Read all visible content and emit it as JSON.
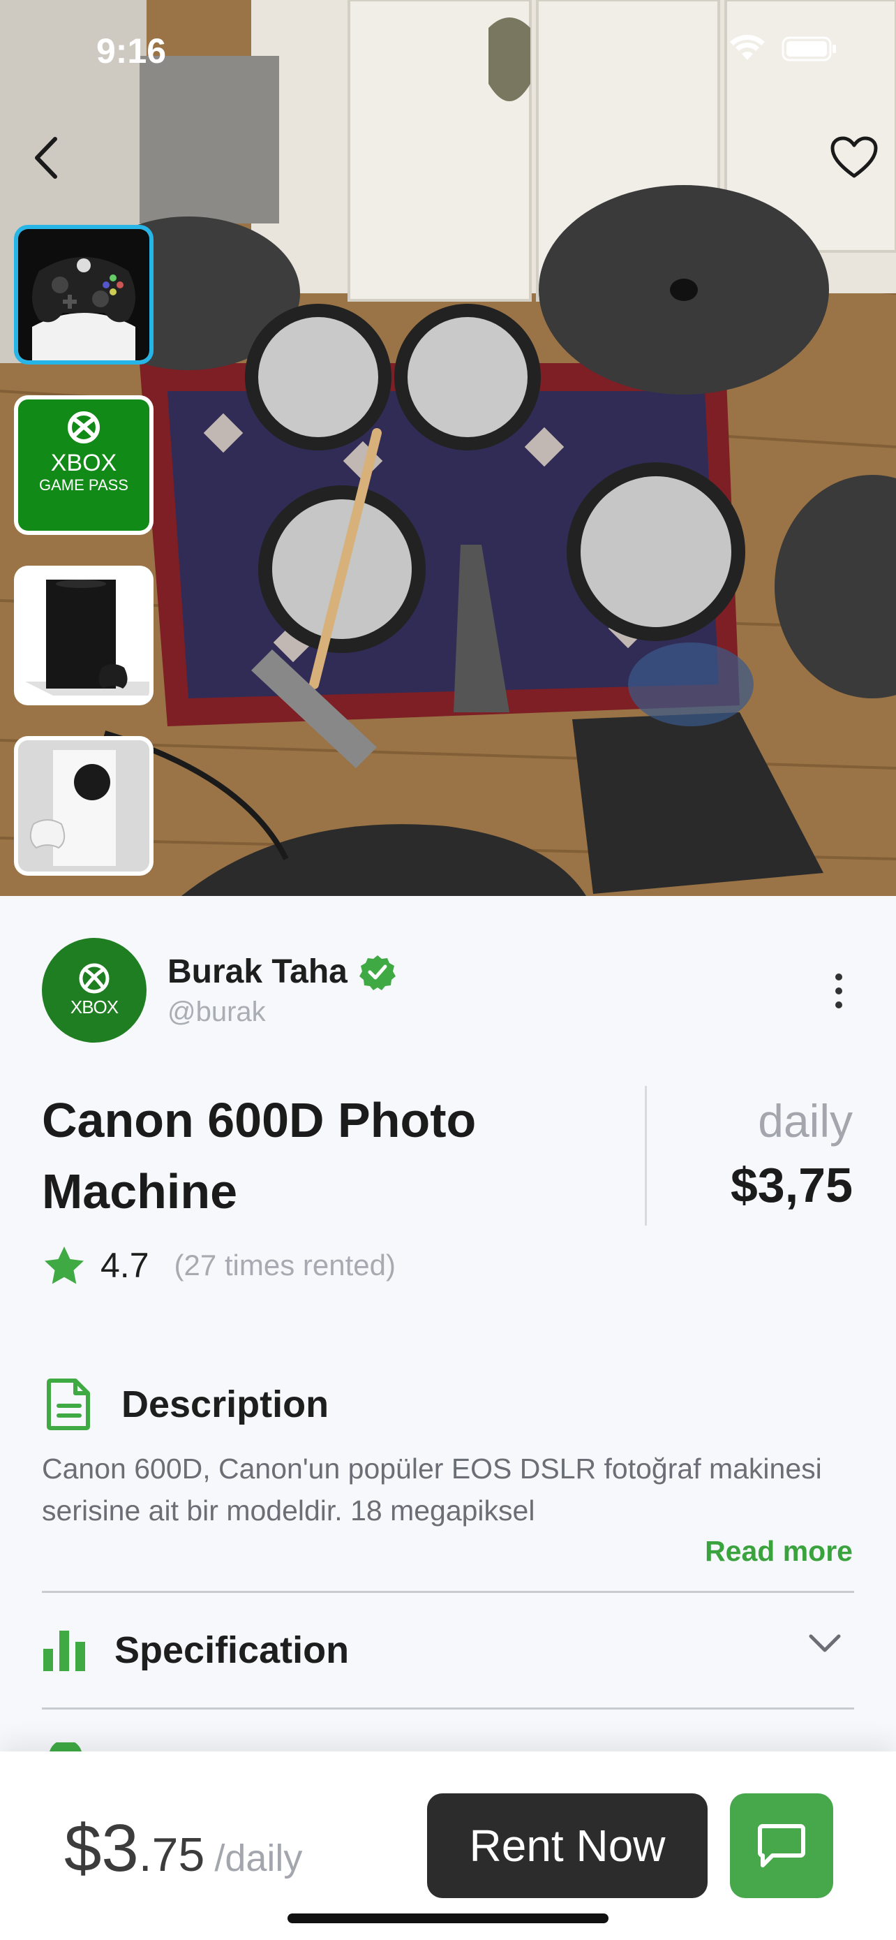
{
  "status_bar": {
    "time": "9:16",
    "icons": [
      "wifi-icon",
      "battery-icon"
    ]
  },
  "hero": {
    "icons": {
      "back": "chevron-left-icon",
      "favorite": "heart-icon"
    },
    "thumbnails": [
      {
        "name": "xbox-controller",
        "selected": true
      },
      {
        "name": "xbox-game-pass",
        "line1": "XBOX",
        "line2": "GAME PASS",
        "selected": false
      },
      {
        "name": "xbox-series-x",
        "selected": false
      },
      {
        "name": "xbox-series-s",
        "selected": false
      }
    ]
  },
  "seller": {
    "avatar_text": "XBOX",
    "name": "Burak Taha",
    "handle": "@burak",
    "verified_icon": "verified-badge-icon"
  },
  "product": {
    "title": "Canon 600D Photo Machine",
    "price_period": "daily",
    "price": "$3,75",
    "rating": "4.7",
    "rating_count": "(27 times rented)"
  },
  "description": {
    "title": "Description",
    "text": "Canon 600D, Canon'un popüler EOS DSLR fotoğraf makinesi serisine ait bir modeldir. 18 megapiksel",
    "read_more": "Read more"
  },
  "specification": {
    "title": "Specification"
  },
  "bottom_bar": {
    "price_int": "$3",
    "price_dec": ".75",
    "price_period": "/daily",
    "rent_label": "Rent Now",
    "chat_icon": "chat-icon"
  },
  "colors": {
    "accent": "#46a84a",
    "dark_button": "#2c2c2c",
    "thumb_selected": "#27b5e8"
  }
}
